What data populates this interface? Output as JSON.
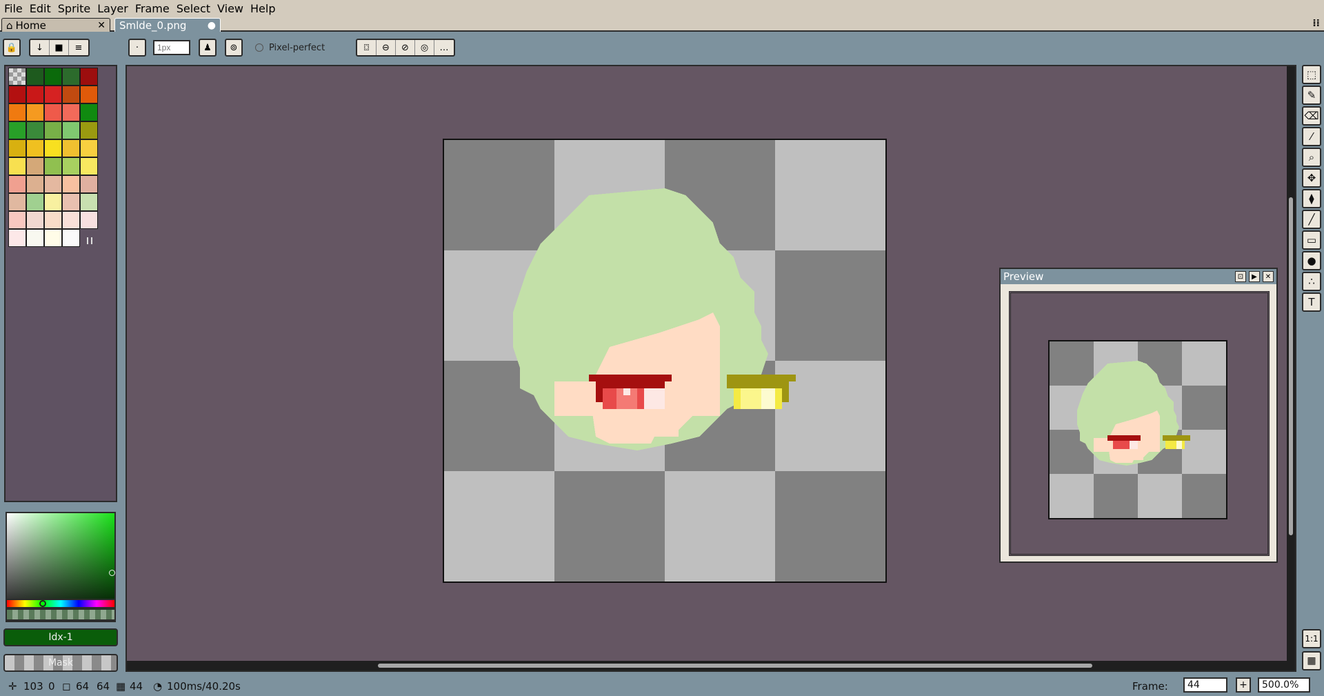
{
  "menu": [
    "File",
    "Edit",
    "Sprite",
    "Layer",
    "Frame",
    "Select",
    "View",
    "Help"
  ],
  "tabs": {
    "home": "Home",
    "file": "Smlde_0.png"
  },
  "toolbar": {
    "brush_size_placeholder": "1px",
    "pixel_perfect": "Pixel-perfect"
  },
  "palette": {
    "colors": [
      "checker",
      "#1e5a1e",
      "#0b6a0b",
      "#2c6b2c",
      "#9c0e0e",
      "#b31010",
      "#c91818",
      "#d62222",
      "#c14a10",
      "#e05a0a",
      "#f07a10",
      "#f59a20",
      "#ef5a4a",
      "#f26a5a",
      "#108a10",
      "#28a028",
      "#3a8a3a",
      "#78b048",
      "#80c870",
      "#9a9a10",
      "#d8b010",
      "#f0c020",
      "#f8e020",
      "#f0c030",
      "#f8d040",
      "#f8e050",
      "#d4a878",
      "#90c050",
      "#a8d060",
      "#f8e860",
      "#f0a090",
      "#dcb090",
      "#e4b8a0",
      "#f8c0a0",
      "#e0b0a0",
      "#e0b8a0",
      "#a0d090",
      "#f8f0a0",
      "#e8c0b0",
      "#c8e0b0",
      "#f8c8c0",
      "#f0d8d0",
      "#f8dcc8",
      "#f8e0d8",
      "#f8e0e0",
      "#fce8e8",
      "#f8f8f0",
      "#fffce8",
      "#fafafa"
    ]
  },
  "fg_color": {
    "label": "Idx-1",
    "color": "#0a5d0a"
  },
  "mask_label": "Mask",
  "preview": {
    "title": "Preview"
  },
  "status": {
    "x": "103",
    "y": "0",
    "width": "64",
    "height": "64",
    "frame": "44",
    "duration": "100ms/40.20s",
    "frame_label": "Frame:",
    "frame_value": "44",
    "zoom": "500.0%"
  },
  "colors": {
    "hair": "#c3e0a8",
    "skin": "#ffdcc4",
    "eye_red_dark": "#a50f0f",
    "eye_red": "#e84a4a",
    "eye_red_light": "#f47a74",
    "eye_yellow_dark": "#9e9512",
    "eye_yellow": "#f4ea44",
    "eye_yellow_light": "#fbf68c"
  }
}
